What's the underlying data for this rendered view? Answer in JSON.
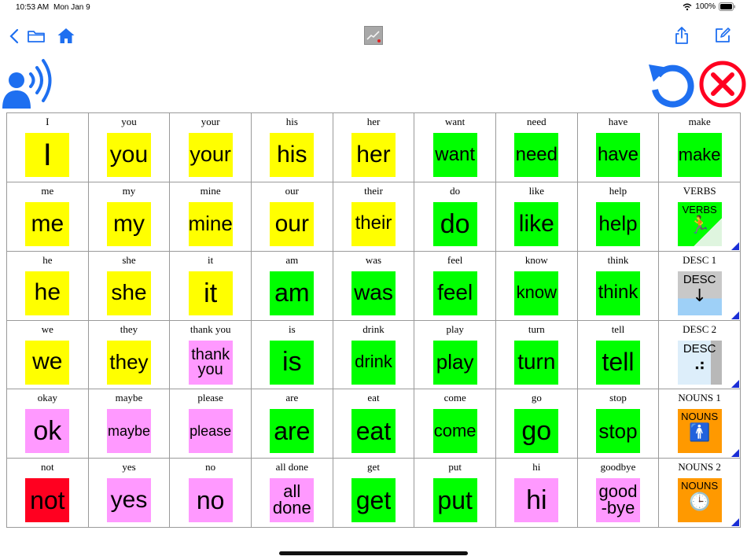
{
  "status_bar": {
    "time": "10:53 AM",
    "date": "Mon Jan 9",
    "battery": "100%"
  },
  "toolbar": {
    "back_icon": "chevron-left-icon",
    "folder_icon": "folder-icon",
    "home_icon": "home-icon",
    "center_icon": "chart-icon",
    "share_icon": "share-icon",
    "edit_icon": "edit-icon"
  },
  "colors": {
    "accent": "#1e6ff0",
    "yellow": "#ffff00",
    "green": "#00ff00",
    "pink": "#ff99ff",
    "red": "#ff0020",
    "orange": "#ff9900",
    "folder_marker": "#1a2ed6"
  },
  "grid": {
    "cells": [
      {
        "caption": "I",
        "label": "I",
        "color": "yellow",
        "size": 40
      },
      {
        "caption": "you",
        "label": "you",
        "color": "yellow",
        "size": 30
      },
      {
        "caption": "your",
        "label": "your",
        "color": "yellow",
        "size": 27
      },
      {
        "caption": "his",
        "label": "his",
        "color": "yellow",
        "size": 30
      },
      {
        "caption": "her",
        "label": "her",
        "color": "yellow",
        "size": 30
      },
      {
        "caption": "want",
        "label": "want",
        "color": "green",
        "size": 24
      },
      {
        "caption": "need",
        "label": "need",
        "color": "green",
        "size": 24
      },
      {
        "caption": "have",
        "label": "have",
        "color": "green",
        "size": 24
      },
      {
        "caption": "make",
        "label": "make",
        "color": "green",
        "size": 22
      },
      {
        "caption": "me",
        "label": "me",
        "color": "yellow",
        "size": 30
      },
      {
        "caption": "my",
        "label": "my",
        "color": "yellow",
        "size": 30
      },
      {
        "caption": "mine",
        "label": "mine",
        "color": "yellow",
        "size": 26
      },
      {
        "caption": "our",
        "label": "our",
        "color": "yellow",
        "size": 30
      },
      {
        "caption": "their",
        "label": "their",
        "color": "yellow",
        "size": 24
      },
      {
        "caption": "do",
        "label": "do",
        "color": "green",
        "size": 34
      },
      {
        "caption": "like",
        "label": "like",
        "color": "green",
        "size": 30
      },
      {
        "caption": "help",
        "label": "help",
        "color": "green",
        "size": 26
      },
      {
        "caption": "VERBS",
        "label": "VERBS",
        "color": "green",
        "size": 13,
        "folder": true,
        "icon": "running-person-icon",
        "glyph": "🏃"
      },
      {
        "caption": "he",
        "label": "he",
        "color": "yellow",
        "size": 30
      },
      {
        "caption": "she",
        "label": "she",
        "color": "yellow",
        "size": 28
      },
      {
        "caption": "it",
        "label": "it",
        "color": "yellow",
        "size": 34
      },
      {
        "caption": "am",
        "label": "am",
        "color": "green",
        "size": 32
      },
      {
        "caption": "was",
        "label": "was",
        "color": "green",
        "size": 28
      },
      {
        "caption": "feel",
        "label": "feel",
        "color": "green",
        "size": 28
      },
      {
        "caption": "know",
        "label": "know",
        "color": "green",
        "size": 22
      },
      {
        "caption": "think",
        "label": "think",
        "color": "green",
        "size": 24
      },
      {
        "caption": "DESC 1",
        "label": "DESC",
        "color": "gray",
        "size": 15,
        "folder": true,
        "icon": "down-arrow-icon",
        "glyph": "↓"
      },
      {
        "caption": "we",
        "label": "we",
        "color": "yellow",
        "size": 30
      },
      {
        "caption": "they",
        "label": "they",
        "color": "yellow",
        "size": 26
      },
      {
        "caption": "thank you",
        "label": "thank you",
        "color": "pink",
        "size": 20
      },
      {
        "caption": "is",
        "label": "is",
        "color": "green",
        "size": 34
      },
      {
        "caption": "drink",
        "label": "drink",
        "color": "green",
        "size": 22
      },
      {
        "caption": "play",
        "label": "play",
        "color": "green",
        "size": 26
      },
      {
        "caption": "turn",
        "label": "turn",
        "color": "green",
        "size": 28
      },
      {
        "caption": "tell",
        "label": "tell",
        "color": "green",
        "size": 32
      },
      {
        "caption": "DESC 2",
        "label": "DESC",
        "color": "lightblue",
        "size": 15,
        "folder": true,
        "icon": "dots-icon",
        "glyph": "⠴"
      },
      {
        "caption": "okay",
        "label": "ok",
        "color": "pink",
        "size": 34
      },
      {
        "caption": "maybe",
        "label": "maybe",
        "color": "pink",
        "size": 18
      },
      {
        "caption": "please",
        "label": "please",
        "color": "pink",
        "size": 18
      },
      {
        "caption": "are",
        "label": "are",
        "color": "green",
        "size": 32
      },
      {
        "caption": "eat",
        "label": "eat",
        "color": "green",
        "size": 32
      },
      {
        "caption": "come",
        "label": "come",
        "color": "green",
        "size": 22
      },
      {
        "caption": "go",
        "label": "go",
        "color": "green",
        "size": 34
      },
      {
        "caption": "stop",
        "label": "stop",
        "color": "green",
        "size": 26
      },
      {
        "caption": "NOUNS 1",
        "label": "NOUNS",
        "color": "orange",
        "size": 13,
        "folder": true,
        "icon": "person-icon",
        "glyph": "🚹"
      },
      {
        "caption": "not",
        "label": "not",
        "color": "red",
        "size": 32
      },
      {
        "caption": "yes",
        "label": "yes",
        "color": "pink",
        "size": 30
      },
      {
        "caption": "no",
        "label": "no",
        "color": "pink",
        "size": 32
      },
      {
        "caption": "all done",
        "label": "all done",
        "color": "pink",
        "size": 22
      },
      {
        "caption": "get",
        "label": "get",
        "color": "green",
        "size": 32
      },
      {
        "caption": "put",
        "label": "put",
        "color": "green",
        "size": 32
      },
      {
        "caption": "hi",
        "label": "hi",
        "color": "pink",
        "size": 34
      },
      {
        "caption": "goodbye",
        "label": "good-bye",
        "color": "pink",
        "size": 22
      },
      {
        "caption": "NOUNS 2",
        "label": "NOUNS",
        "color": "orange",
        "size": 13,
        "folder": true,
        "icon": "clock-icon",
        "glyph": "🕒"
      }
    ]
  }
}
